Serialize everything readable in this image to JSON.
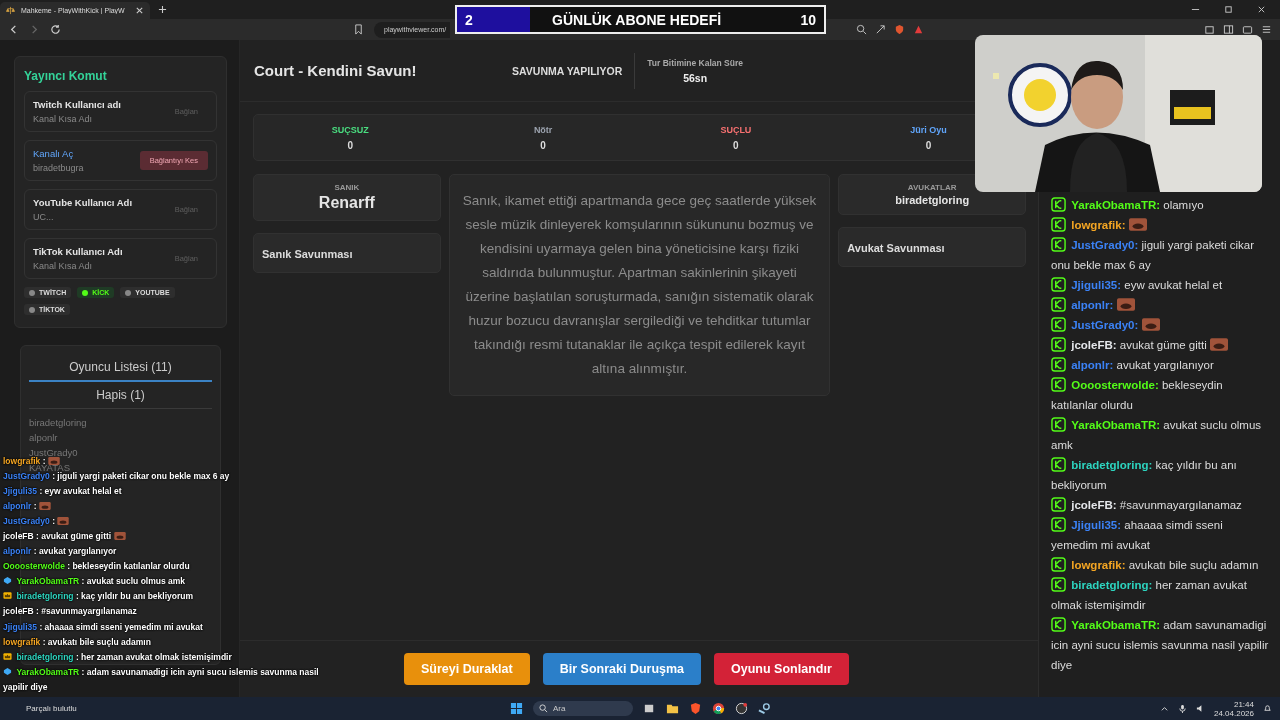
{
  "browser": {
    "tab_title": "Mahkeme - PlayWithKick | PlayW",
    "url": "playwithviewer.com/"
  },
  "goal_overlay": {
    "current": "2",
    "title": "GÜNLÜK ABONE HEDEFİ",
    "target": "10",
    "level": 0.2
  },
  "sidebar": {
    "title": "Yayıncı Komut",
    "connections": [
      {
        "label": "Twitch Kullanıcı adı",
        "placeholder": "Kanal Kısa Adı",
        "button": "Bağlan",
        "connected": false
      },
      {
        "label": "Kanalı Aç",
        "value": "biradetbugra",
        "button": "Bağlantıyı Kes",
        "connected": true
      },
      {
        "label": "YouTube Kullanıcı Adı",
        "placeholder": "UC...",
        "button": "Bağlan",
        "connected": false
      },
      {
        "label": "TikTok Kullanıcı Adı",
        "placeholder": "Kanal Kısa Adı",
        "button": "Bağlan",
        "connected": false
      }
    ],
    "platforms": [
      {
        "label": "TWİTCH",
        "on": false
      },
      {
        "label": "KİCK",
        "on": true
      },
      {
        "label": "YOUTUBE",
        "on": false
      },
      {
        "label": "TİKTOK",
        "on": false
      }
    ]
  },
  "player_panel": {
    "tabs": [
      {
        "label": "Oyuncu Listesi (11)",
        "selected": true
      },
      {
        "label": "Hapis (1)",
        "selected": false
      }
    ],
    "players": [
      "biradetgloring",
      "alponlr",
      "JustGrady0",
      "KAYATAS"
    ]
  },
  "game": {
    "title": "Court - Kendini Savun!",
    "phase": "SAVUNMA YAPILIYOR",
    "timer_label": "Tur Bitimine Kalan Süre",
    "timer": "56sn",
    "votes": [
      {
        "label": "SUÇSUZ",
        "count": "0",
        "color": "#4ade80"
      },
      {
        "label": "Nötr",
        "count": "0",
        "color": "#9ca3af"
      },
      {
        "label": "SUÇLU",
        "count": "0",
        "color": "#f87171"
      },
      {
        "label": "Jüri Oyu",
        "count": "0",
        "color": "#60a5fa"
      }
    ],
    "defendant_label": "SANIK",
    "defendant": "Renarff",
    "defense_title": "Sanık Savunması",
    "case_text": "Sanık, ikamet ettiği apartmanda gece geç saatlerde yüksek sesle müzik dinleyerek komşularının sükununu bozmuş ve kendisini uyarmaya gelen bina yöneticisine karşı fiziki saldırıda bulunmuştur. Apartman sakinlerinin şikayeti üzerine başlatılan soruşturmada, sanığın sistematik olarak huzur bozucu davranışlar sergilediği ve tehditkar tutumlar takındığı resmi tutanaklar ile açıkça tespit edilerek kayıt altına alınmıştır.",
    "lawyers_label": "AVUKATLAR",
    "lawyers": "biradetgloring",
    "lawyer_defense_title": "Avukat Savunması",
    "buttons": [
      {
        "label": "Süreyi Duraklat",
        "color": "#e8900c"
      },
      {
        "label": "Bir Sonraki Duruşma",
        "color": "#2b7fc9"
      },
      {
        "label": "Oyunu Sonlandır",
        "color": "#d32237"
      }
    ]
  },
  "chat": [
    {
      "user": "YarakObamaTR:",
      "color": "#53fc18",
      "text": "olamıyo"
    },
    {
      "user": "lowgrafik:",
      "color": "#f5a623",
      "emote": true
    },
    {
      "user": "JustGrady0:",
      "color": "#3b82f6",
      "text": "jiguli yargi paketi cikar onu bekle max 6 ay"
    },
    {
      "user": "Jjiguli35:",
      "color": "#3b82f6",
      "text": "eyw avukat helal et"
    },
    {
      "user": "alponlr:",
      "color": "#3b82f6",
      "emote": true
    },
    {
      "user": "JustGrady0:",
      "color": "#3b82f6",
      "emote": true
    },
    {
      "user": "jcoleFB:",
      "color": "#e5e7eb",
      "text": "avukat güme gitti",
      "emote": true
    },
    {
      "user": "alponlr:",
      "color": "#3b82f6",
      "text": "avukat yargılanıyor"
    },
    {
      "user": "Oooosterwolde:",
      "color": "#53fc18",
      "text": "bekleseydin katılanlar olurdu"
    },
    {
      "user": "YarakObamaTR:",
      "color": "#53fc18",
      "text": "avukat suclu olmus amk"
    },
    {
      "user": "biradetgloring:",
      "color": "#2dd4bf",
      "text": "kaç yıldır bu anı bekliyorum"
    },
    {
      "user": "jcoleFB:",
      "color": "#e5e7eb",
      "text": "#savunmayargılanamaz"
    },
    {
      "user": "Jjiguli35:",
      "color": "#3b82f6",
      "text": "ahaaaa simdi sseni yemedim mi avukat"
    },
    {
      "user": "lowgrafik:",
      "color": "#f5a623",
      "text": "avukatı bile suçlu adamın"
    },
    {
      "user": "biradetgloring:",
      "color": "#2dd4bf",
      "text": "her zaman avukat olmak istemişimdir"
    },
    {
      "user": "YarakObamaTR:",
      "color": "#53fc18",
      "text": "adam savunamadigi icin ayni sucu islemis savunma nasil yapilir diye"
    }
  ],
  "overlay_chat": [
    {
      "kind": "plain",
      "user": "lowgrafik",
      "color": "#f5a623",
      "text": ":",
      "emote": true
    },
    {
      "kind": "plain",
      "user": "JustGrady0",
      "color": "#3b82f6",
      "text": ": jiguli yargi paketi cikar onu bekle max 6 ay"
    },
    {
      "kind": "plain",
      "user": "Jjiguli35",
      "color": "#3b82f6",
      "text": ": eyw avukat helal et"
    },
    {
      "kind": "plain",
      "user": "alponlr",
      "color": "#3b82f6",
      "text": ":",
      "emote": true
    },
    {
      "kind": "plain",
      "user": "JustGrady0",
      "color": "#3b82f6",
      "text": ":",
      "emote": true
    },
    {
      "kind": "plain",
      "user": "jcoleFB",
      "color": "#ffffff",
      "text": ": avukat güme gitti",
      "emote": true
    },
    {
      "kind": "plain",
      "user": "alponlr",
      "color": "#3b82f6",
      "text": ": avukat yargılanıyor"
    },
    {
      "kind": "plain",
      "user": "Oooosterwolde",
      "color": "#53fc18",
      "text": ": bekleseydin katılanlar olurdu"
    },
    {
      "kind": "gem",
      "user": "YarakObamaTR",
      "color": "#53fc18",
      "text": ": avukat suclu olmus amk"
    },
    {
      "kind": "crown",
      "user": "biradetgloring",
      "color": "#2dd4bf",
      "text": ": kaç yıldır bu anı bekliyorum"
    },
    {
      "kind": "plain",
      "user": "jcoleFB",
      "color": "#ffffff",
      "text": ": #savunmayargılanamaz"
    },
    {
      "kind": "plain",
      "user": "Jjiguli35",
      "color": "#3b82f6",
      "text": ": ahaaaa simdi sseni yemedim mi avukat"
    },
    {
      "kind": "plain",
      "user": "lowgrafik",
      "color": "#f5a623",
      "text": ": avukatı bile suçlu adamın"
    },
    {
      "kind": "crown",
      "user": "biradetgloring",
      "color": "#2dd4bf",
      "text": ": her zaman avukat olmak istemişimdir"
    },
    {
      "kind": "gem",
      "user": "YarakObamaTR",
      "color": "#53fc18",
      "text": ": adam savunamadigi icin ayni sucu islemis savunma nasil yapilir diye"
    }
  ],
  "taskbar": {
    "search_placeholder": "Ara",
    "weather": "Parçalı bulutlu",
    "time": "21:44",
    "date": "24.04.2026"
  }
}
